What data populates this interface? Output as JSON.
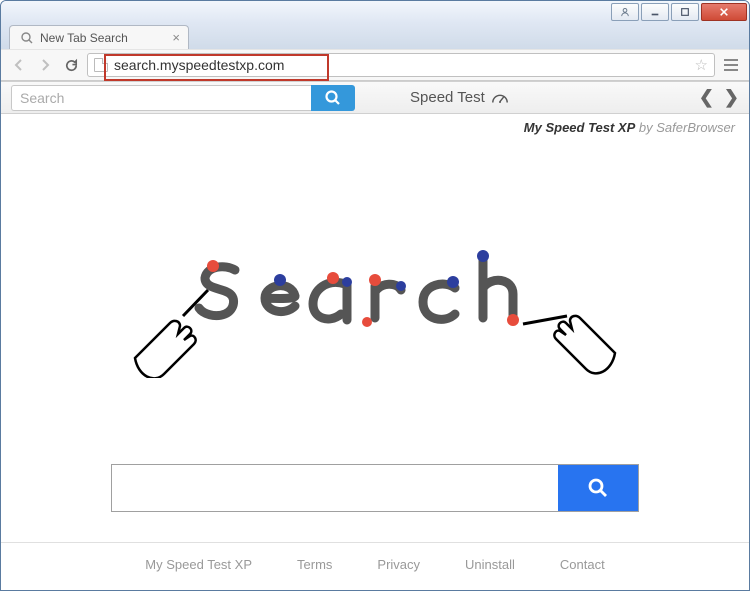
{
  "browser": {
    "tab_title": "New Tab Search",
    "url": "search.myspeedtestxp.com"
  },
  "toolbar": {
    "search_placeholder": "Search",
    "speedtest_label": "Speed Test"
  },
  "branding": {
    "title": "My Speed Test XP",
    "byline": "by SaferBrowser"
  },
  "footer": {
    "links": [
      "My Speed Test XP",
      "Terms",
      "Privacy",
      "Uninstall",
      "Contact"
    ]
  }
}
